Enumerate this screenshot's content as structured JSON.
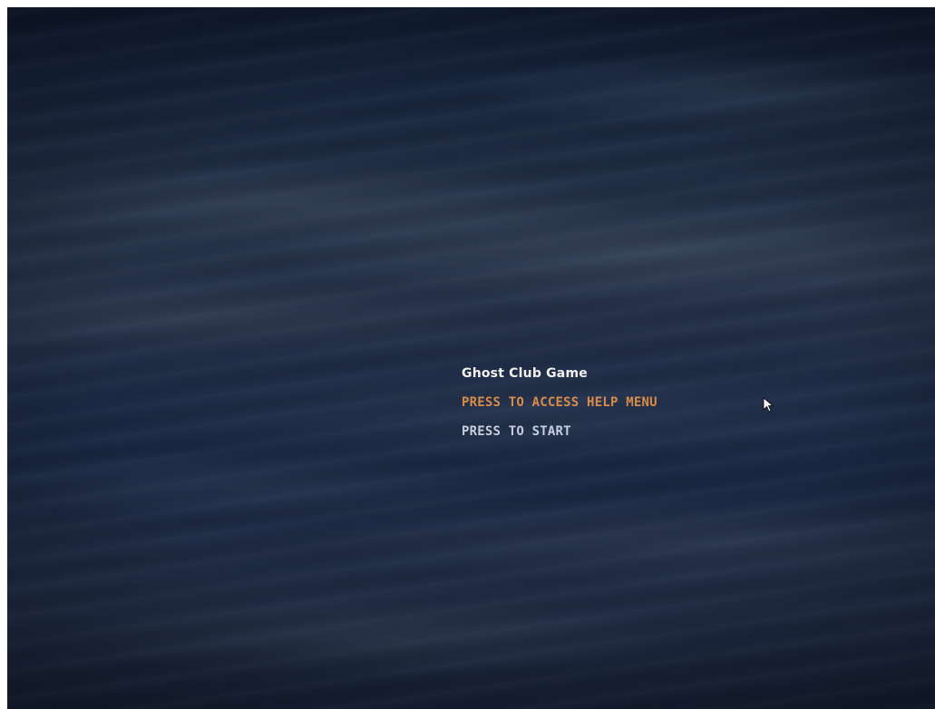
{
  "game": {
    "title": "Ghost Club Game",
    "menu": {
      "help_label": "PRESS TO ACCESS HELP MENU",
      "start_label": "PRESS TO START"
    }
  },
  "colors": {
    "title": "#f2f2f2",
    "help": "#d98c4a",
    "start": "#c8cde0",
    "background": "#1f2c43",
    "frame": "#ffffff"
  },
  "icons": {
    "cursor": "mouse-pointer-icon"
  }
}
